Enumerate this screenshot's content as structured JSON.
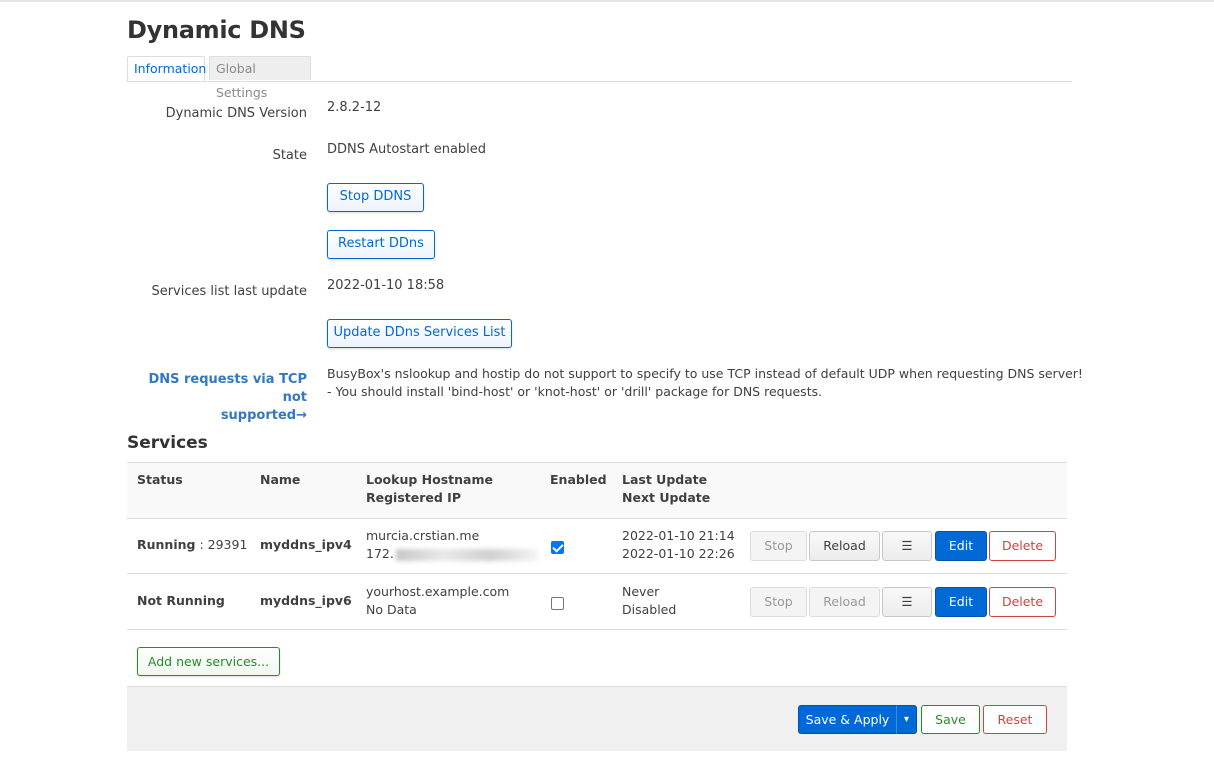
{
  "page": {
    "title": "Dynamic DNS"
  },
  "tabs": [
    {
      "label": "Information",
      "active": true
    },
    {
      "label": "Global Settings",
      "active": false
    }
  ],
  "info": {
    "version_label": "Dynamic DNS Version",
    "version_value": "2.8.2-12",
    "state_label": "State",
    "state_value": "DDNS Autostart enabled",
    "stop_button": "Stop DDNS",
    "restart_button": "Restart DDns",
    "services_update_label": "Services list last update",
    "services_update_value": "2022-01-10 18:58",
    "update_button": "Update DDns Services List",
    "warning_label_line1": "DNS requests via TCP not",
    "warning_label_line2": "supported→",
    "warning_text_line1": "BusyBox's nslookup and hostip do not support to specify to use TCP instead of default UDP when requesting DNS server!",
    "warning_text_line2": "- You should install 'bind-host' or 'knot-host' or 'drill' package for DNS requests."
  },
  "services": {
    "heading": "Services",
    "columns": {
      "status": "Status",
      "name": "Name",
      "lookup_hostname": "Lookup Hostname",
      "registered_ip": "Registered IP",
      "enabled": "Enabled",
      "last_update": "Last Update",
      "next_update": "Next Update"
    },
    "rows": [
      {
        "status": "Running",
        "status_extra": " : 29391",
        "name": "myddns_ipv4",
        "hostname": "murcia.crstian.me",
        "ip": "172.",
        "enabled": true,
        "last_update": "2022-01-10 21:14",
        "next_update": "2022-01-10 22:26"
      },
      {
        "status": "Not Running",
        "status_extra": "",
        "name": "myddns_ipv6",
        "hostname": "yourhost.example.com",
        "ip": "No Data",
        "enabled": false,
        "last_update": "Never",
        "next_update": "Disabled"
      }
    ],
    "row_buttons": {
      "stop": "Stop",
      "reload": "Reload",
      "menu": "☰",
      "edit": "Edit",
      "delete": "Delete"
    },
    "add_button": "Add new services..."
  },
  "footer": {
    "save_apply": "Save & Apply",
    "dropdown_caret": "▾",
    "save": "Save",
    "reset": "Reset"
  },
  "colors": {
    "primary": "#0069d6",
    "positive": "#2a8a2a",
    "negative": "#cc4444",
    "link": "#3378c2"
  }
}
